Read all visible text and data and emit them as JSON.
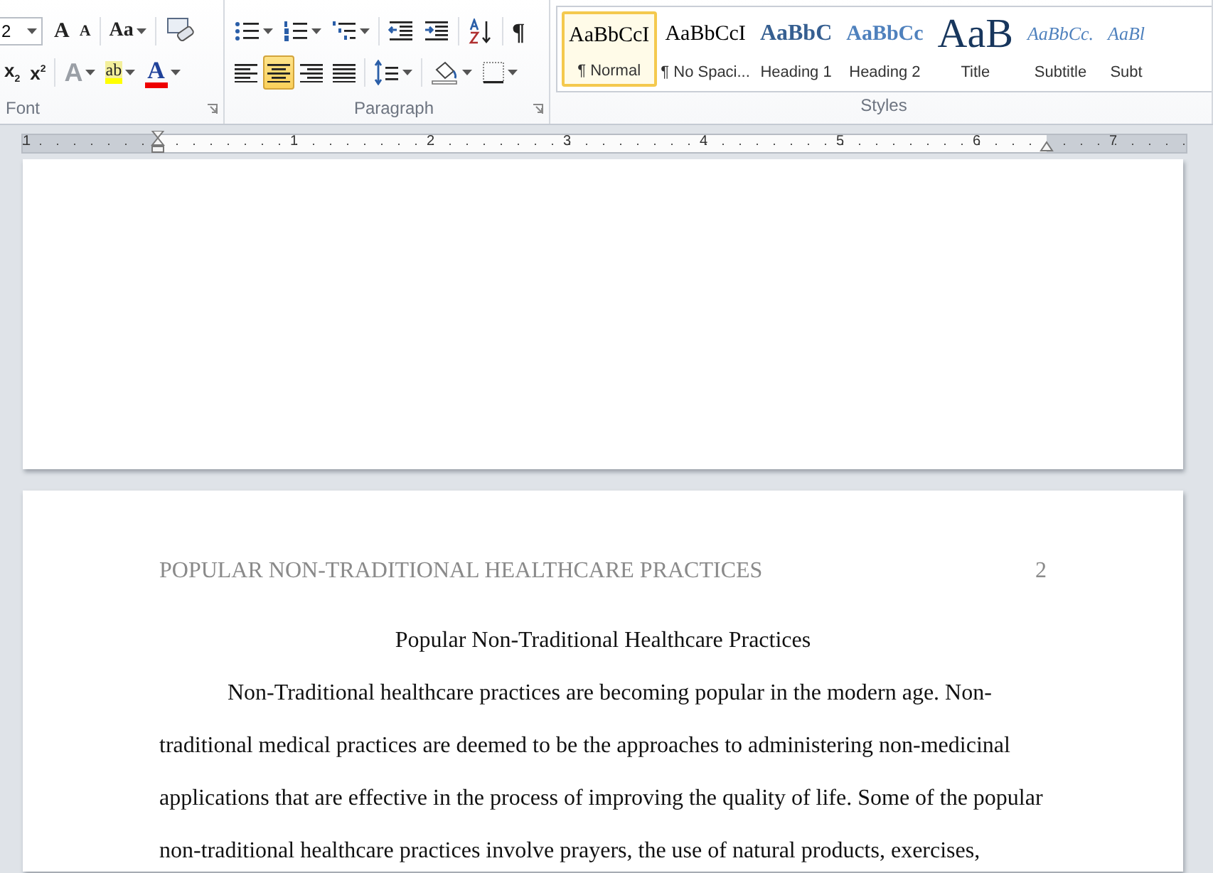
{
  "ribbon": {
    "groups": [
      {
        "label": "Font",
        "kind": "font",
        "rows": [
          [
            {
              "kind": "size_field",
              "value": "2",
              "dropdown": true
            },
            {
              "kind": "grow",
              "glyph": "A",
              "dropdown": false
            },
            {
              "kind": "shrink",
              "glyph": "A",
              "dropdown": false
            },
            {
              "kind": "case",
              "glyph": "Aa",
              "dropdown": true
            },
            {
              "kind": "clear",
              "dropdown": false
            }
          ],
          [
            {
              "kind": "subscript",
              "glyph": "x$_{2}$",
              "dropdown": false
            },
            {
              "kind": "superscript",
              "glyph": "x$^{2}$",
              "dropdown": false
            },
            {
              "kind": "effects",
              "glyph": "A",
              "dropdown": true
            },
            {
              "kind": "highlight",
              "glyph": "ab",
              "dropdown": true
            },
            {
              "kind": "font_color",
              "glyph": "A",
              "dropdown": true
            }
          ]
        ]
      },
      {
        "label": "Paragraph",
        "kind": "paragraph",
        "rows": [
          [
            {
              "kind": "bullets",
              "dropdown": true
            },
            {
              "kind": "numbering",
              "dropdown": true
            },
            {
              "kind": "multilevel",
              "dropdown": true
            },
            {
              "kind": "outdent",
              "dropdown": false
            },
            {
              "kind": "indent",
              "dropdown": false
            },
            {
              "kind": "sort",
              "dropdown": false
            },
            {
              "kind": "pilcrow",
              "glyph": "¶",
              "dropdown": false
            }
          ],
          [
            {
              "kind": "align_left",
              "selected": false,
              "dropdown": false
            },
            {
              "kind": "align_center",
              "selected": true,
              "dropdown": false
            },
            {
              "kind": "align_right",
              "selected": false,
              "dropdown": false
            },
            {
              "kind": "justify",
              "selected": false,
              "dropdown": false
            },
            {
              "kind": "spacing",
              "dropdown": true
            },
            {
              "kind": "shading",
              "dropdown": true
            },
            {
              "kind": "borders",
              "dropdown": true
            }
          ]
        ]
      }
    ],
    "styles": {
      "label": "Styles",
      "items": [
        {
          "preview": "AaBbCcI",
          "name": "¶ Normal",
          "kind": "plain",
          "selected": true
        },
        {
          "preview": "AaBbCcI",
          "name": "¶ No Spaci...",
          "kind": "plain",
          "selected": false
        },
        {
          "preview": "AaBbC",
          "name": "Heading 1",
          "kind": "heading1",
          "selected": false
        },
        {
          "preview": "AaBbCc",
          "name": "Heading 2",
          "kind": "heading2",
          "selected": false
        },
        {
          "preview": "AaB",
          "name": "Title",
          "kind": "title",
          "selected": false
        },
        {
          "preview": "AaBbCc.",
          "name": "Subtitle",
          "kind": "subtitle",
          "selected": false
        },
        {
          "preview": "AaBl",
          "name": "Subt",
          "kind": "subtitle",
          "selected": false
        }
      ]
    }
  },
  "ruler": {
    "labels": [
      "1",
      "1",
      "2",
      "3",
      "4",
      "5",
      "6",
      "7"
    ]
  },
  "document": {
    "header_text": "POPULAR NON-TRADITIONAL HEALTHCARE PRACTICES",
    "page_number": "2",
    "title": "Popular Non-Traditional Healthcare Practices",
    "paragraph_lines": [
      "Non-Traditional healthcare practices are becoming popular in the modern age. Non-",
      "traditional medical practices are deemed to be the approaches to administering non-medicinal",
      "applications that are effective in the process of improving the quality of life. Some of the popular",
      "non-traditional healthcare practices involve prayers, the use of natural products, exercises,"
    ]
  }
}
